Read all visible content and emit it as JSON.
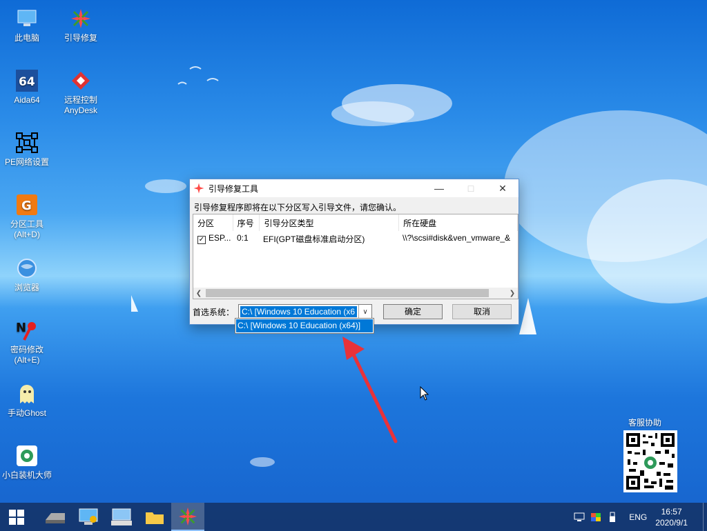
{
  "desktop": {
    "icons": [
      {
        "label": "此电脑",
        "icon": "computer-icon"
      },
      {
        "label": "引导修复",
        "icon": "boot-repair-icon"
      },
      {
        "label": "Aida64",
        "icon": "aida64-icon"
      },
      {
        "label": "远程控制",
        "label2": "AnyDesk",
        "icon": "anydesk-icon"
      },
      {
        "label": "PE网络设置",
        "icon": "network-icon"
      },
      {
        "label": "分区工具",
        "label2": "(Alt+D)",
        "icon": "partition-icon"
      },
      {
        "label": "浏览器",
        "icon": "browser-icon"
      },
      {
        "label": "密码修改",
        "label2": "(Alt+E)",
        "icon": "password-icon"
      },
      {
        "label": "手动Ghost",
        "icon": "ghost-icon"
      },
      {
        "label": "小白装机大师",
        "icon": "xiaobai-icon"
      }
    ],
    "qr_label": "客服协助"
  },
  "dialog": {
    "title": "引导修复工具",
    "message": "引导修复程序即将在以下分区写入引导文件，请您确认。",
    "columns": [
      "分区",
      "序号",
      "引导分区类型",
      "所在硬盘"
    ],
    "rows": [
      {
        "checked": true,
        "partition": "ESP...",
        "index": "0:1",
        "type": "EFI(GPT磁盘标准启动分区)",
        "disk": "\\\\?\\scsi#disk&ven_vmware_&"
      }
    ],
    "system_label": "首选系统：",
    "system_value": "C:\\ [Windows 10 Education (x6",
    "dropdown_option": "C:\\ [Windows 10 Education (x64)]",
    "ok_label": "确定",
    "cancel_label": "取消"
  },
  "taskbar": {
    "apps": [
      "start-icon",
      "drive-icon",
      "computer-manage-icon",
      "keyboard-icon",
      "folder-icon",
      "boot-repair-icon"
    ],
    "language": "ENG",
    "time": "16:57",
    "date": "2020/9/1"
  }
}
